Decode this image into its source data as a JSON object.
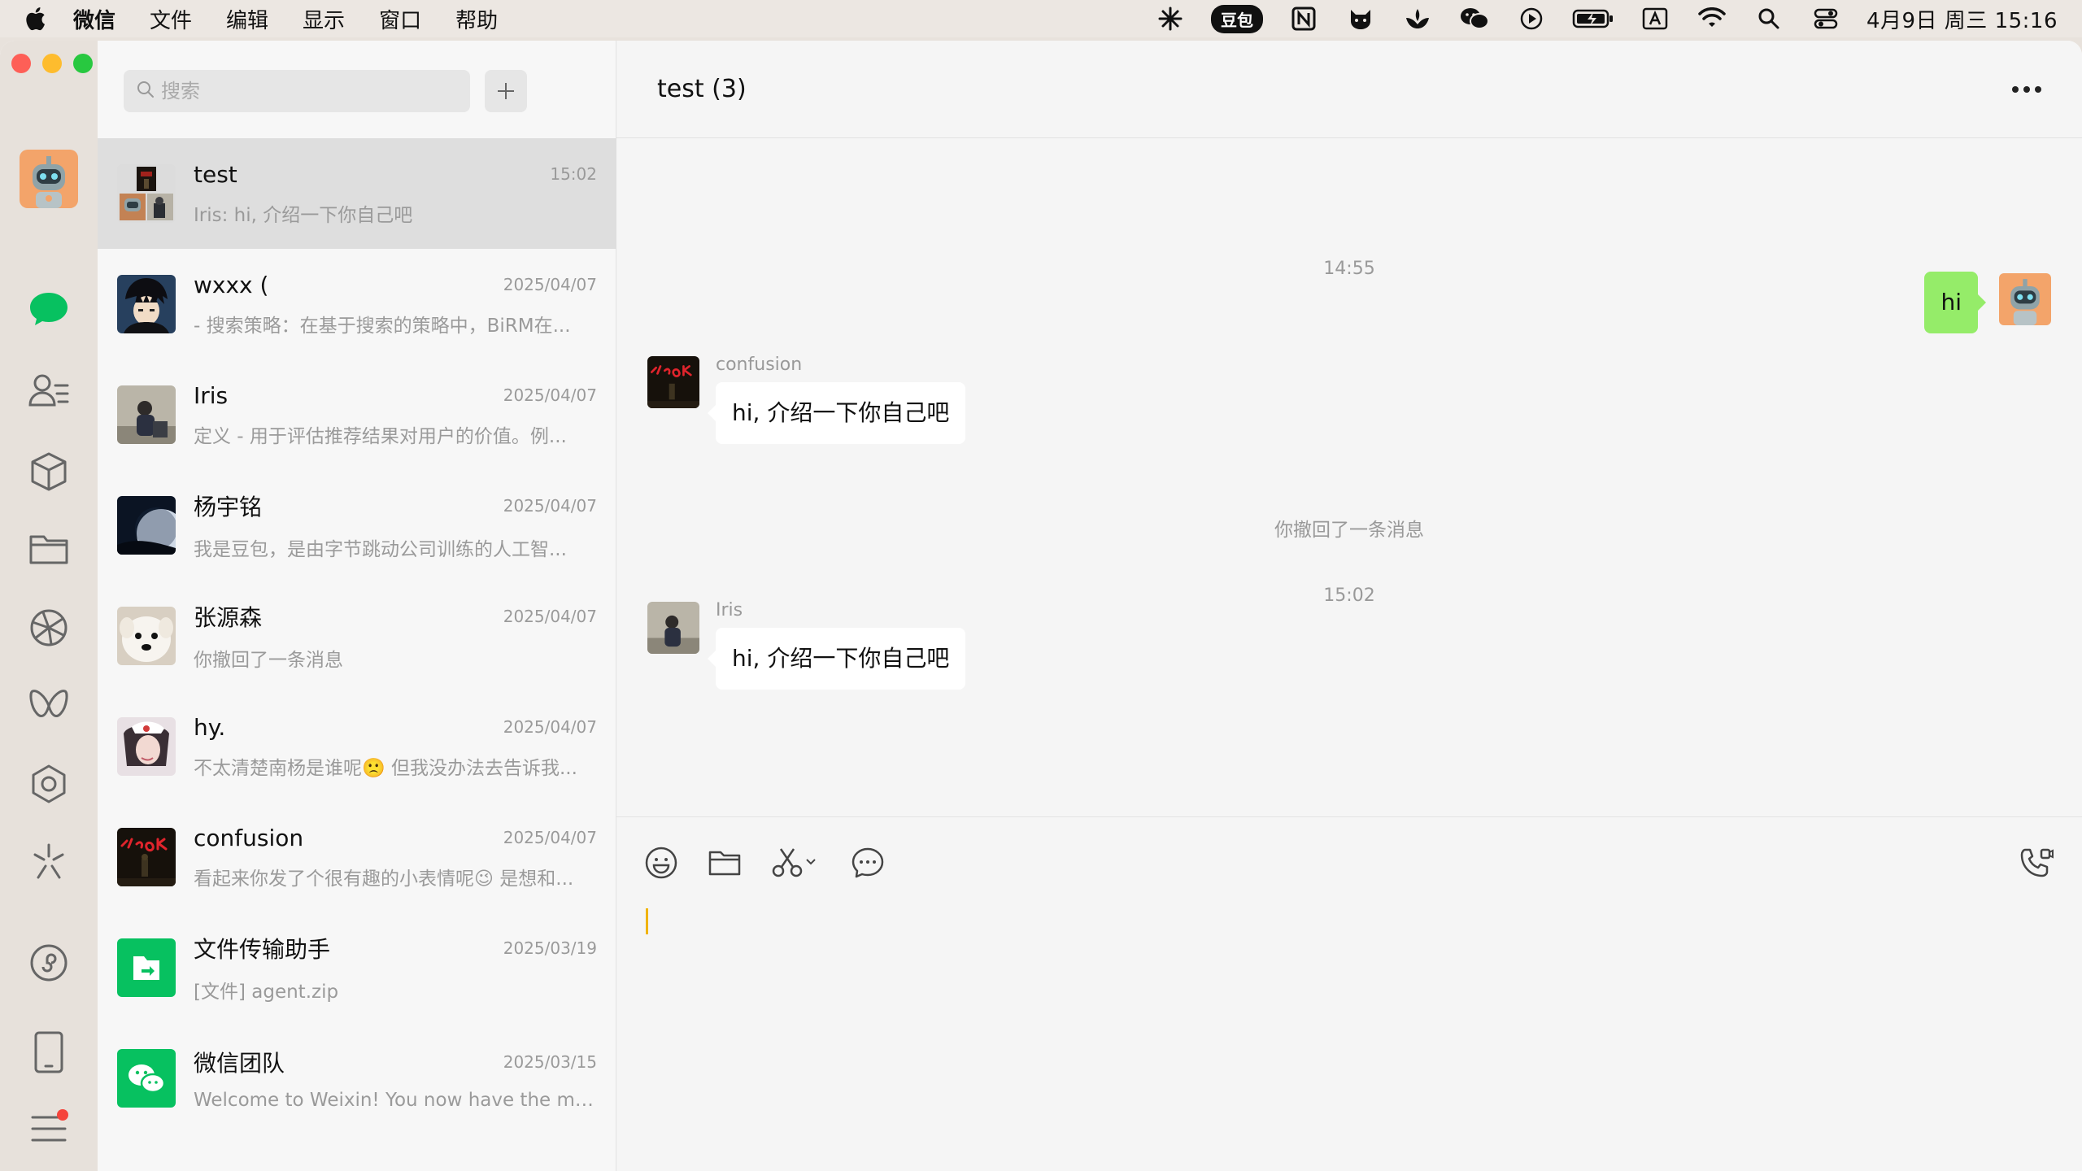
{
  "menubar": {
    "app_name": "微信",
    "menus": [
      "文件",
      "编辑",
      "显示",
      "窗口",
      "帮助"
    ],
    "doubao": "豆包",
    "clock": "4月9日 周三  15:16"
  },
  "search": {
    "placeholder": "搜索"
  },
  "chats": [
    {
      "name": "test",
      "time": "15:02",
      "preview": "Iris: hi, 介绍一下你自己吧",
      "avatar": "group-avatar"
    },
    {
      "name": "wxxx (",
      "time": "2025/04/07",
      "preview": "- 搜索策略：在基于搜索的策略中，BiRM在...",
      "avatar": "anime-boy-avatar"
    },
    {
      "name": "Iris",
      "time": "2025/04/07",
      "preview": "定义  - 用于评估推荐结果对用户的价值。例...",
      "avatar": "person-avatar"
    },
    {
      "name": "杨宇铭",
      "time": "2025/04/07",
      "preview": "我是豆包，是由字节跳动公司训练的人工智...",
      "avatar": "moon-avatar"
    },
    {
      "name": "张源森",
      "time": "2025/04/07",
      "preview": "你撤回了一条消息",
      "avatar": "dog-avatar"
    },
    {
      "name": "hy.",
      "time": "2025/04/07",
      "preview": "不太清楚南杨是谁呢🙁 但我没办法去告诉我...",
      "avatar": "girl-avatar"
    },
    {
      "name": "confusion",
      "time": "2025/04/07",
      "preview": "看起来你发了个很有趣的小表情呢😉 是想和...",
      "avatar": "neon-avatar"
    },
    {
      "name": "文件传输助手",
      "time": "2025/03/19",
      "preview": "[文件] agent.zip",
      "avatar": "file-transfer-avatar"
    },
    {
      "name": "微信团队",
      "time": "2025/03/15",
      "preview": "Welcome to Weixin! You now have the mos...",
      "avatar": "wechat-team-avatar"
    }
  ],
  "conversation": {
    "title": "test  (3)",
    "time1": "14:55",
    "my_msg": "hi",
    "sender1": "confusion",
    "msg1": "hi, 介绍一下你自己吧",
    "recall": "你撤回了一条消息",
    "time2": "15:02",
    "sender2": "Iris",
    "msg2": "hi, 介绍一下你自己吧"
  },
  "colors": {
    "accent_green": "#07c160",
    "bubble_green": "#95ec69",
    "notification_red": "#f5443b"
  }
}
